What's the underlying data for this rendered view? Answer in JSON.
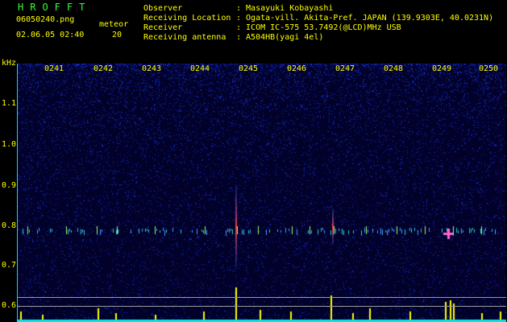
{
  "header": {
    "title": "HROFFT",
    "filename": "06050240.png",
    "meteor_label": "meteor",
    "datetime": "02.06.05 02:40",
    "meteor_count": "20"
  },
  "info": {
    "observer_label": "Observer",
    "observer_value": ": Masayuki Kobayashi",
    "location_label": "Receiving Location",
    "location_value": ": Ogata-vill. Akita-Pref. JAPAN (139.9303E, 40.0231N)",
    "receiver_label": "Receiver",
    "receiver_value": ": ICOM IC-575 53.7492(@LCD)MHz USB",
    "antenna_label": "Receiving antenna",
    "antenna_value": ": A504HB(yagi 4el)"
  },
  "axes": {
    "y_unit": "kHz",
    "y_ticks": [
      "1.1",
      "1.0",
      "0.9",
      "0.8",
      "0.7",
      "0.6"
    ],
    "x_ticks": [
      "0241",
      "0242",
      "0243",
      "0244",
      "0245",
      "0246",
      "0247",
      "0248",
      "0249",
      "0250"
    ]
  },
  "colors": {
    "noise": "#1a2fd8",
    "background": "#01012a",
    "echo_line": "#ff3b3b",
    "trace": "#ffff00",
    "baseline": "#00e8e8",
    "labels": "#ffff00",
    "title": "#33ff33"
  }
}
